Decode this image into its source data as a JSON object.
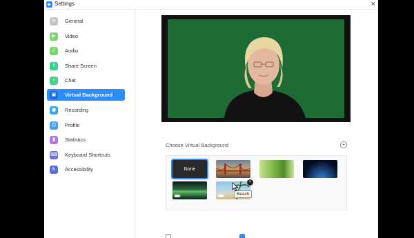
{
  "window": {
    "title": "Settings",
    "close_glyph": "×",
    "app_icon": "zoom-camera-icon"
  },
  "sidebar": {
    "items": [
      {
        "label": "General",
        "icon": "gear-icon",
        "icon_color": "#c4c4c4",
        "glyph": "⚙",
        "active": false
      },
      {
        "label": "Video",
        "icon": "video-camera-icon",
        "icon_color": "#7cd66e",
        "glyph": "▶",
        "active": false
      },
      {
        "label": "Audio",
        "icon": "headphones-icon",
        "icon_color": "#7cd66e",
        "glyph": "♪",
        "active": false
      },
      {
        "label": "Share Screen",
        "icon": "share-screen-icon",
        "icon_color": "#3ccf8e",
        "glyph": "↑",
        "active": false
      },
      {
        "label": "Chat",
        "icon": "chat-icon",
        "icon_color": "#4cd18a",
        "glyph": "•",
        "active": false
      },
      {
        "label": "Virtual Background",
        "icon": "virtual-background-icon",
        "icon_color": "#2d8cff",
        "glyph": "▣",
        "active": true
      },
      {
        "label": "Recording",
        "icon": "recording-icon",
        "icon_color": "#3aa7f5",
        "glyph": "●",
        "active": false
      },
      {
        "label": "Profile",
        "icon": "profile-icon",
        "icon_color": "#4b9dfb",
        "glyph": "☺",
        "active": false
      },
      {
        "label": "Statistics",
        "icon": "statistics-icon",
        "icon_color": "#b57ae0",
        "glyph": "▮",
        "active": false
      },
      {
        "label": "Keyboard Shortcuts",
        "icon": "keyboard-icon",
        "icon_color": "#6b6fd6",
        "glyph": "⌨",
        "active": false
      },
      {
        "label": "Accessibility",
        "icon": "accessibility-icon",
        "icon_color": "#5a6fd8",
        "glyph": "♿",
        "active": false
      }
    ]
  },
  "main": {
    "preview_label": "",
    "section_label": "Choose Virtual Background",
    "add_glyph": "+",
    "backgrounds": [
      {
        "name": "None",
        "label": "None",
        "selected": true
      },
      {
        "name": "Golden Gate Bridge",
        "label": "",
        "selected": false
      },
      {
        "name": "Grass",
        "label": "",
        "selected": false
      },
      {
        "name": "Earth",
        "label": "",
        "selected": false
      },
      {
        "name": "Aurora",
        "label": "",
        "selected": false,
        "video": true
      },
      {
        "name": "Beach",
        "label": "",
        "selected": false,
        "video": true
      }
    ],
    "tooltip": "Beach",
    "remove_glyph": "×"
  }
}
